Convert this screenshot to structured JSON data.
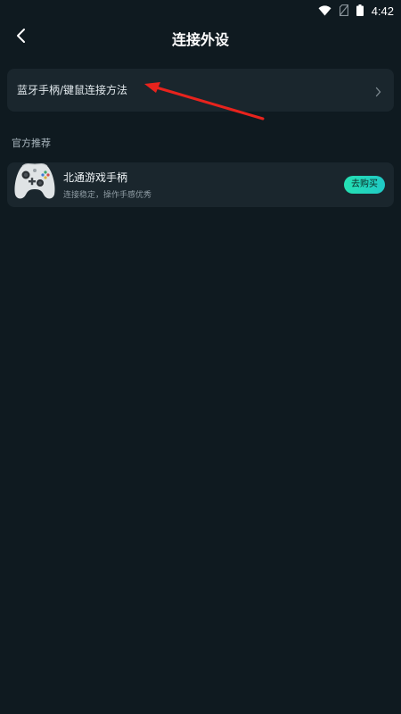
{
  "status_bar": {
    "time": "4:42",
    "icons": [
      "wifi-icon",
      "no-sim-icon",
      "battery-icon"
    ]
  },
  "header": {
    "title": "连接外设",
    "back_icon": "chevron-left-icon"
  },
  "help_row": {
    "label": "蓝牙手柄/键鼠连接方法",
    "chevron_icon": "chevron-right-icon"
  },
  "recommend_section": {
    "title": "官方推荐",
    "products": [
      {
        "name": "北通游戏手柄",
        "description": "连接稳定，操作手感优秀",
        "buy_label": "去购买",
        "image": "gamepad-image"
      }
    ]
  },
  "colors": {
    "background": "#0f1a20",
    "card": "#1a262d",
    "accent": "#25e0b2",
    "annotation": "#e8231d"
  }
}
